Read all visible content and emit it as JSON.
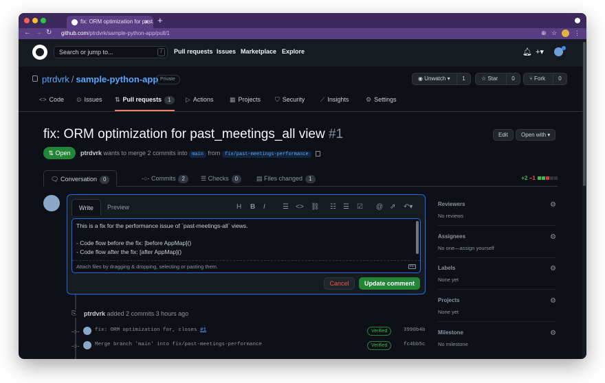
{
  "browser": {
    "tab_title": "fix: ORM optimization for past...",
    "url_host": "github.com",
    "url_path": "/ptrdvrk/sample-python-app/pull/1"
  },
  "header": {
    "search_placeholder": "Search or jump to...",
    "search_key": "/",
    "nav": [
      "Pull requests",
      "Issues",
      "Marketplace",
      "Explore"
    ]
  },
  "repo": {
    "owner": "ptrdvrk",
    "name": "sample-python-app",
    "visibility": "Private",
    "unwatch_label": "Unwatch",
    "unwatch_count": "1",
    "star_label": "Star",
    "star_count": "0",
    "fork_label": "Fork",
    "fork_count": "0",
    "tabs": [
      {
        "label": "Code"
      },
      {
        "label": "Issues"
      },
      {
        "label": "Pull requests",
        "count": "1"
      },
      {
        "label": "Actions"
      },
      {
        "label": "Projects"
      },
      {
        "label": "Security"
      },
      {
        "label": "Insights"
      },
      {
        "label": "Settings"
      }
    ]
  },
  "pr": {
    "title": "fix: ORM optimization for past_meetings_all view",
    "number": "#1",
    "edit_label": "Edit",
    "open_with_label": "Open with",
    "status": "Open",
    "author": "ptrdvrk",
    "meta_text": "wants to merge 2 commits into",
    "base_branch": "main",
    "from_text": "from",
    "head_branch": "fix/past-meetings-performance",
    "tabs": [
      {
        "label": "Conversation",
        "count": "0"
      },
      {
        "label": "Commits",
        "count": "2"
      },
      {
        "label": "Checks",
        "count": "0"
      },
      {
        "label": "Files changed",
        "count": "1"
      }
    ],
    "additions": "+2",
    "deletions": "−1"
  },
  "editor": {
    "write_tab": "Write",
    "preview_tab": "Preview",
    "lines": [
      "This is a fix for the performance issue of `past-meetings-all` views.",
      "",
      "- Code flow before the fix: [before AppMap]()",
      "- Code flow after the fix: [after AppMap]()"
    ],
    "attach_hint": "Attach files by dragging & dropping, selecting or pasting them.",
    "md_badge": "MD",
    "cancel_label": "Cancel",
    "update_label": "Update comment"
  },
  "timeline": {
    "author": "ptrdvrk",
    "event_text": "added 2 commits",
    "time": "3 hours ago",
    "commits": [
      {
        "message": "fix: ORM optimization for, closes ",
        "ref": "#1",
        "verified": "Verified",
        "sha": "3990b4b"
      },
      {
        "message": "Merge branch 'main' into fix/past-meetings-performance",
        "ref": "",
        "verified": "Verified",
        "sha": "fc4bb5c"
      }
    ]
  },
  "sidebar": [
    {
      "label": "Reviewers",
      "value": "No reviews"
    },
    {
      "label": "Assignees",
      "value": "No one—assign yourself"
    },
    {
      "label": "Labels",
      "value": "None yet"
    },
    {
      "label": "Projects",
      "value": "None yet"
    },
    {
      "label": "Milestone",
      "value": "No milestone"
    }
  ],
  "colors": {
    "accent": "#58a6ff",
    "success": "#238636",
    "danger": "#f85149",
    "tab_underline": "#f78166"
  }
}
